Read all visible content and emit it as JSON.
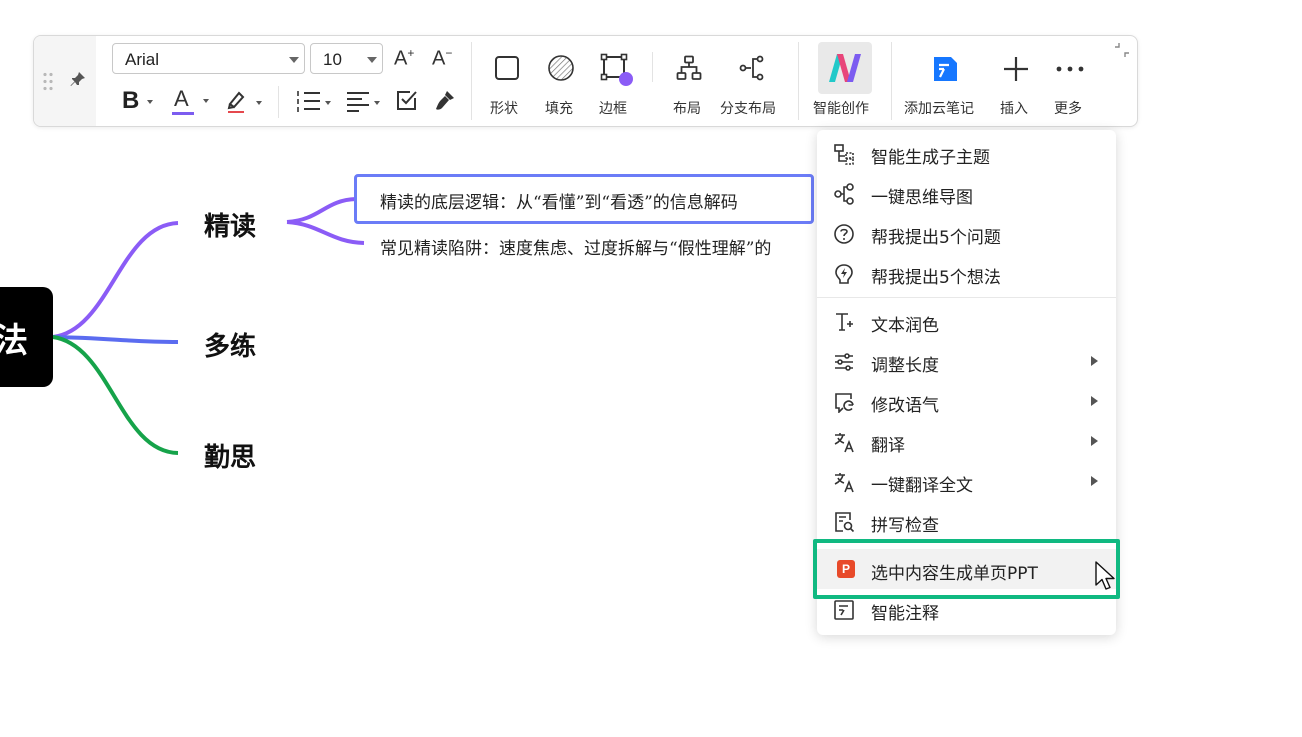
{
  "toolbar": {
    "font_family": "Arial",
    "font_size": "10",
    "shape_label": "形状",
    "fill_label": "填充",
    "border_label": "边框",
    "layout_label": "布局",
    "branch_layout_label": "分支布局",
    "ai_create_label": "智能创作",
    "add_cloud_note_label": "添加云笔记",
    "insert_label": "插入",
    "more_label": "更多",
    "font_color": "#7c5cf0",
    "accent_purple": "#8b5cf6",
    "cloud_note_color": "#1677ff"
  },
  "mindmap": {
    "root_label": "法",
    "branches": [
      "精读",
      "多练",
      "勤思"
    ],
    "branch_colors": [
      "#8b5cf6",
      "#5b6cf0",
      "#16a34a"
    ],
    "subtopics": [
      "精读的底层逻辑：从“看懂”到“看透”的信息解码",
      "常见精读陷阱：速度焦虑、过度拆解与“假性理解”的"
    ]
  },
  "menu": {
    "items": [
      {
        "label": "智能生成子主题",
        "icon": "subtopic-generate-icon",
        "submenu": false
      },
      {
        "label": "一键思维导图",
        "icon": "mindmap-share-icon",
        "submenu": false
      },
      {
        "label": "帮我提出5个问题",
        "icon": "question-circle-icon",
        "submenu": false
      },
      {
        "label": "帮我提出5个想法",
        "icon": "lightbulb-bolt-icon",
        "submenu": false
      },
      {
        "label": "文本润色",
        "icon": "text-polish-icon",
        "submenu": false
      },
      {
        "label": "调整长度",
        "icon": "adjust-length-icon",
        "submenu": true
      },
      {
        "label": "修改语气",
        "icon": "tone-icon",
        "submenu": true
      },
      {
        "label": "翻译",
        "icon": "translate-icon",
        "submenu": true
      },
      {
        "label": "一键翻译全文",
        "icon": "translate-all-icon",
        "submenu": true
      },
      {
        "label": "拼写检查",
        "icon": "spell-check-icon",
        "submenu": false
      },
      {
        "label": "选中内容生成单页PPT",
        "icon": "ppt-icon",
        "submenu": false
      },
      {
        "label": "智能注释",
        "icon": "smart-annotation-icon",
        "submenu": false
      }
    ],
    "ppt_badge": "P",
    "highlight_color": "#10b981"
  }
}
